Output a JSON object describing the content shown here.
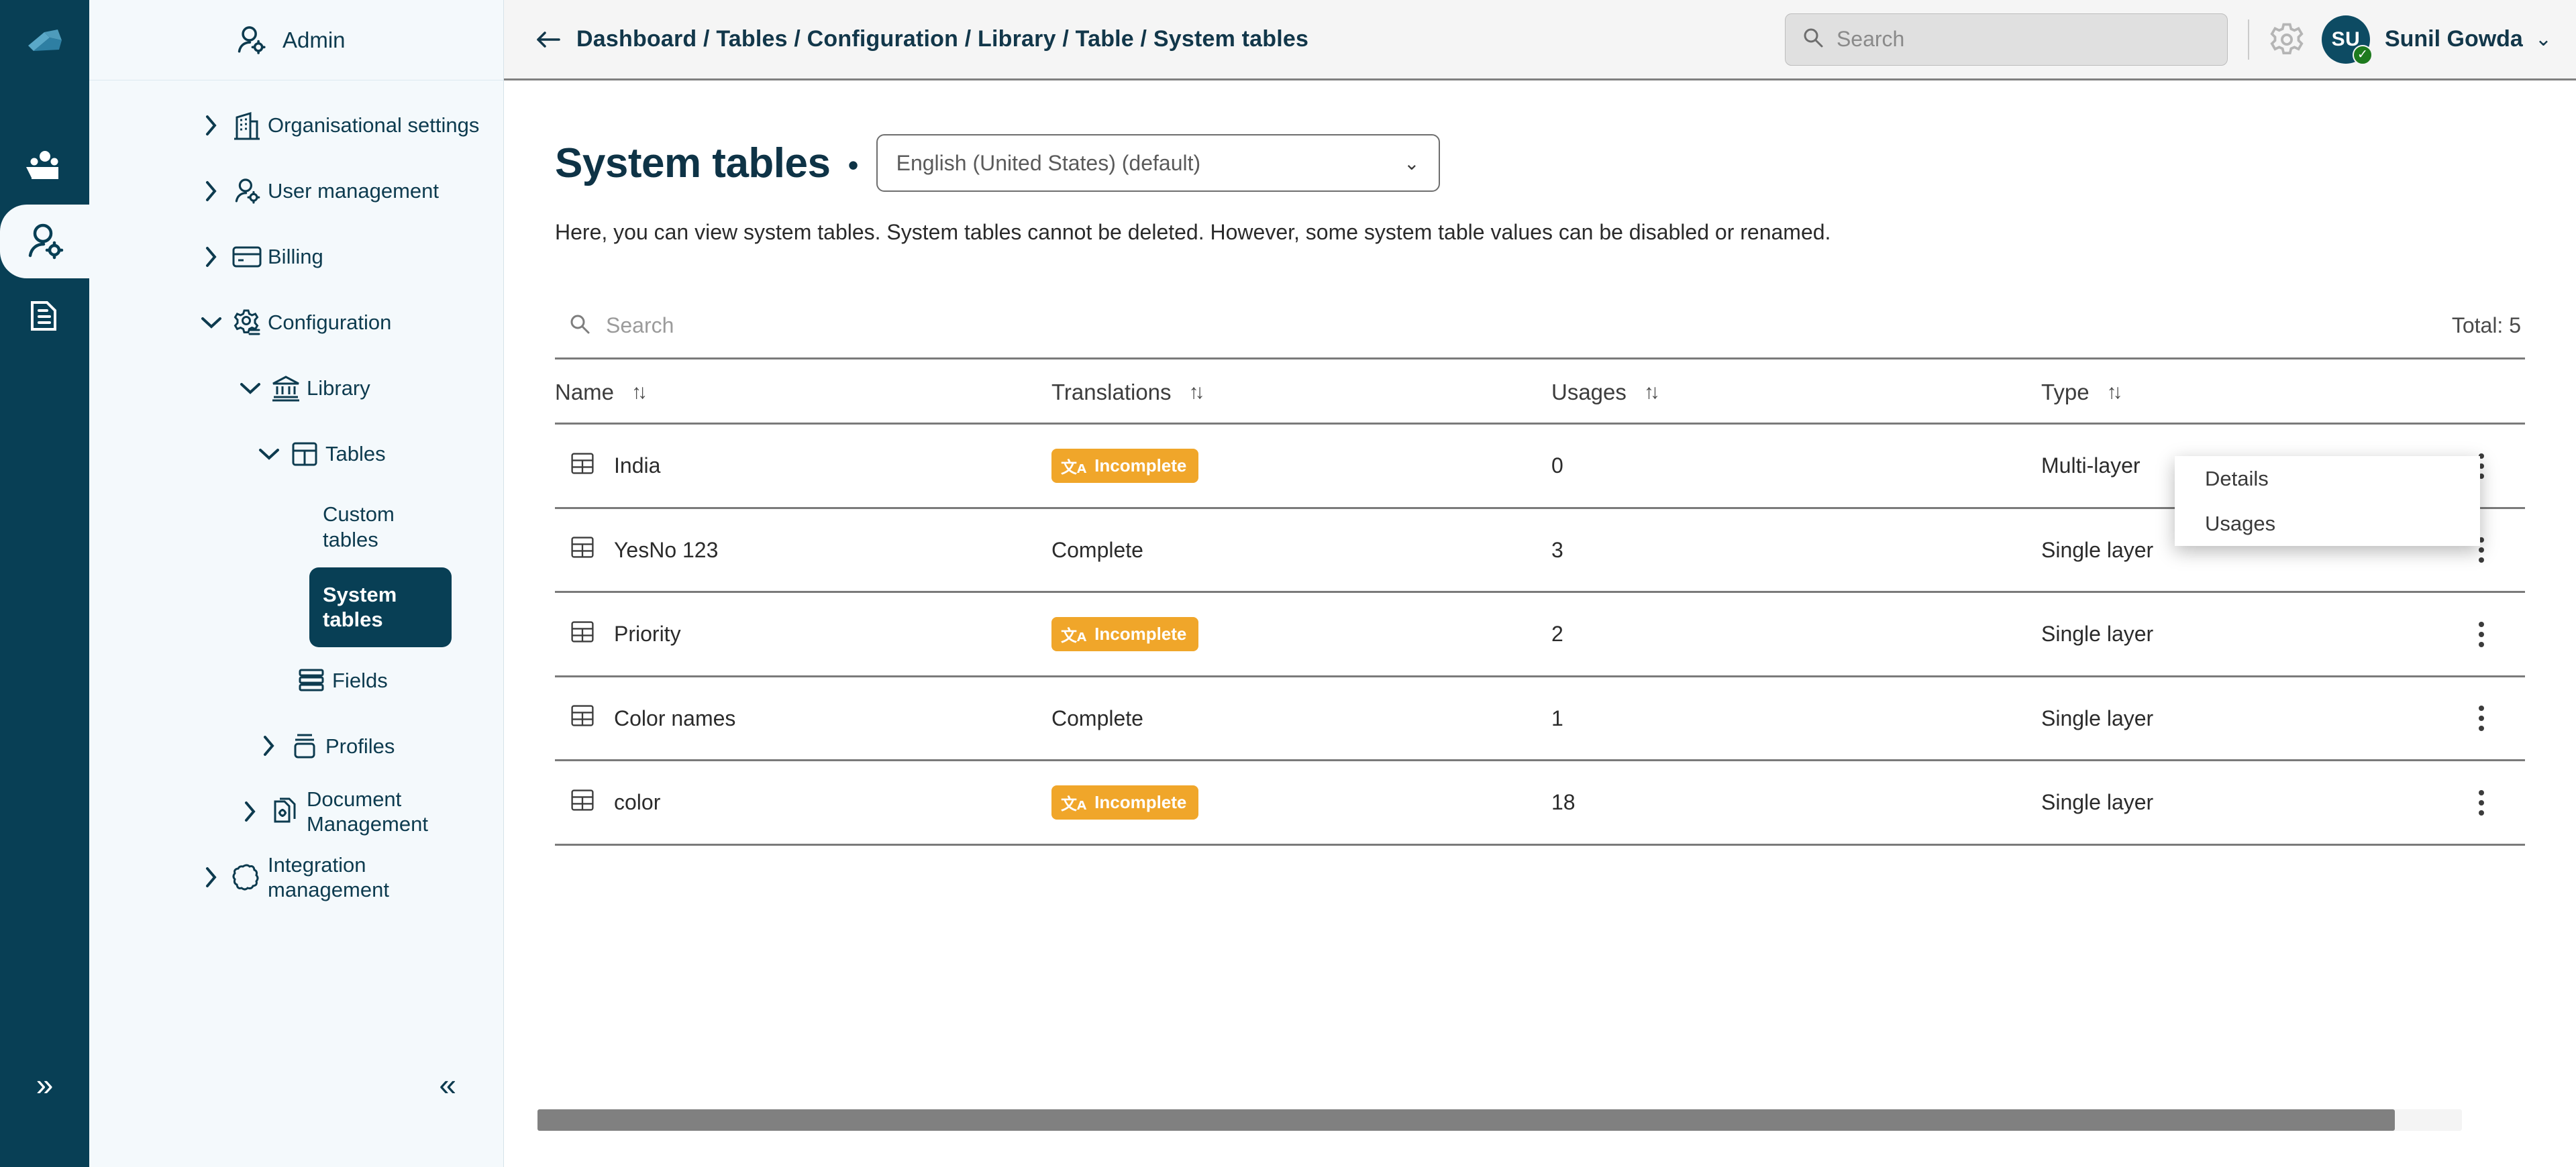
{
  "rail": {
    "logo_icon": "cube-logo-icon",
    "items": [
      {
        "name": "briefcase-folder-icon",
        "active": false
      },
      {
        "name": "user-settings-icon",
        "active": true
      },
      {
        "name": "document-settings-icon",
        "active": false
      }
    ],
    "expand_label": "»"
  },
  "nav": {
    "header": {
      "label": "Admin",
      "icon": "user-settings-icon"
    },
    "items": [
      {
        "label": "Organisational settings",
        "icon": "building-icon",
        "chevron": "right",
        "level": 1
      },
      {
        "label": "User management",
        "icon": "user-settings-icon",
        "chevron": "right",
        "level": 1
      },
      {
        "label": "Billing",
        "icon": "credit-card-icon",
        "chevron": "right",
        "level": 1
      },
      {
        "label": "Configuration",
        "icon": "gear-list-icon",
        "chevron": "down",
        "level": 1
      },
      {
        "label": "Library",
        "icon": "bank-icon",
        "chevron": "down",
        "level": 2
      },
      {
        "label": "Tables",
        "icon": "table-grid-icon",
        "chevron": "down",
        "level": 3
      }
    ],
    "leaves": [
      {
        "label": "Custom tables",
        "active": false
      },
      {
        "label": "System tables",
        "active": true
      }
    ],
    "items_after": [
      {
        "label": "Fields",
        "icon": "rows-icon",
        "chevron": "none",
        "level": 4
      },
      {
        "label": "Profiles",
        "icon": "profile-stack-icon",
        "chevron": "right",
        "level": 3
      },
      {
        "label": "Document Management",
        "icon": "document-settings-icon",
        "chevron": "right",
        "level": 2
      },
      {
        "label": "Integration management",
        "icon": "puzzle-icon",
        "chevron": "right",
        "level": 1
      }
    ],
    "collapse_label": "«"
  },
  "topbar": {
    "back_icon": "arrow-left-icon",
    "breadcrumb": "Dashboard / Tables / Configuration / Library / Table / System tables",
    "search_placeholder": "Search",
    "search_value": "",
    "search_icon": "search-icon",
    "settings_icon": "gear-icon",
    "avatar_initials": "SU",
    "avatar_status_icon": "check-icon",
    "user_name": "Sunil Gowda",
    "user_chevron": "⌄"
  },
  "page": {
    "title": "System tables",
    "separator_dot": "•",
    "language_value": "English (United States) (default)",
    "language_chevron": "⌄",
    "description": "Here, you can view system tables. System tables cannot be deleted. However, some system table values can be disabled or renamed."
  },
  "table": {
    "search_placeholder": "Search",
    "search_value": "",
    "search_icon": "search-icon",
    "total_label": "Total: 5",
    "sort_icon": "↑↓",
    "columns": [
      "Name",
      "Translations",
      "Usages",
      "Type"
    ],
    "rows": [
      {
        "icon": "table-grid-icon",
        "name": "India",
        "translations": "Incomplete",
        "translations_state": "incomplete",
        "usages": "0",
        "type": "Multi-layer"
      },
      {
        "icon": "table-grid-icon",
        "name": "YesNo 123",
        "translations": "Complete",
        "translations_state": "complete",
        "usages": "3",
        "type": "Single layer"
      },
      {
        "icon": "table-grid-icon",
        "name": "Priority",
        "translations": "Incomplete",
        "translations_state": "incomplete",
        "usages": "2",
        "type": "Single layer"
      },
      {
        "icon": "table-grid-icon",
        "name": "Color names",
        "translations": "Complete",
        "translations_state": "complete",
        "usages": "1",
        "type": "Single layer"
      },
      {
        "icon": "table-grid-icon",
        "name": "color",
        "translations": "Incomplete",
        "translations_state": "incomplete",
        "usages": "18",
        "type": "Single layer"
      }
    ],
    "row_menu_icon": "kebab-menu-icon",
    "badge_icon": "translate-icon"
  },
  "context_menu": {
    "items": [
      {
        "label": "Details"
      },
      {
        "label": "Usages"
      }
    ]
  },
  "colors": {
    "brand_dark": "#083F55",
    "nav_bg": "#F4F9FC",
    "badge_orange": "#F0A62A",
    "avatar_blue": "#0D4B63",
    "status_green": "#1E7A1E",
    "rule_gray": "#7A7A7A"
  }
}
